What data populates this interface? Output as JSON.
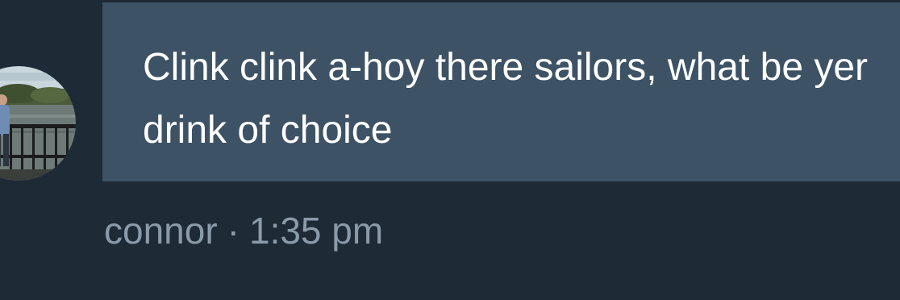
{
  "message": {
    "text": "Clink clink a-hoy there sailors, what be yer drink of choice",
    "author": "connor",
    "separator": "·",
    "time": "1:35 pm"
  },
  "avatar": {
    "icon": "user-photo-avatar"
  },
  "colors": {
    "background": "#1e2a36",
    "bubble": "#3d5264",
    "text": "#ffffff",
    "meta_text": "#8a9aa8"
  }
}
